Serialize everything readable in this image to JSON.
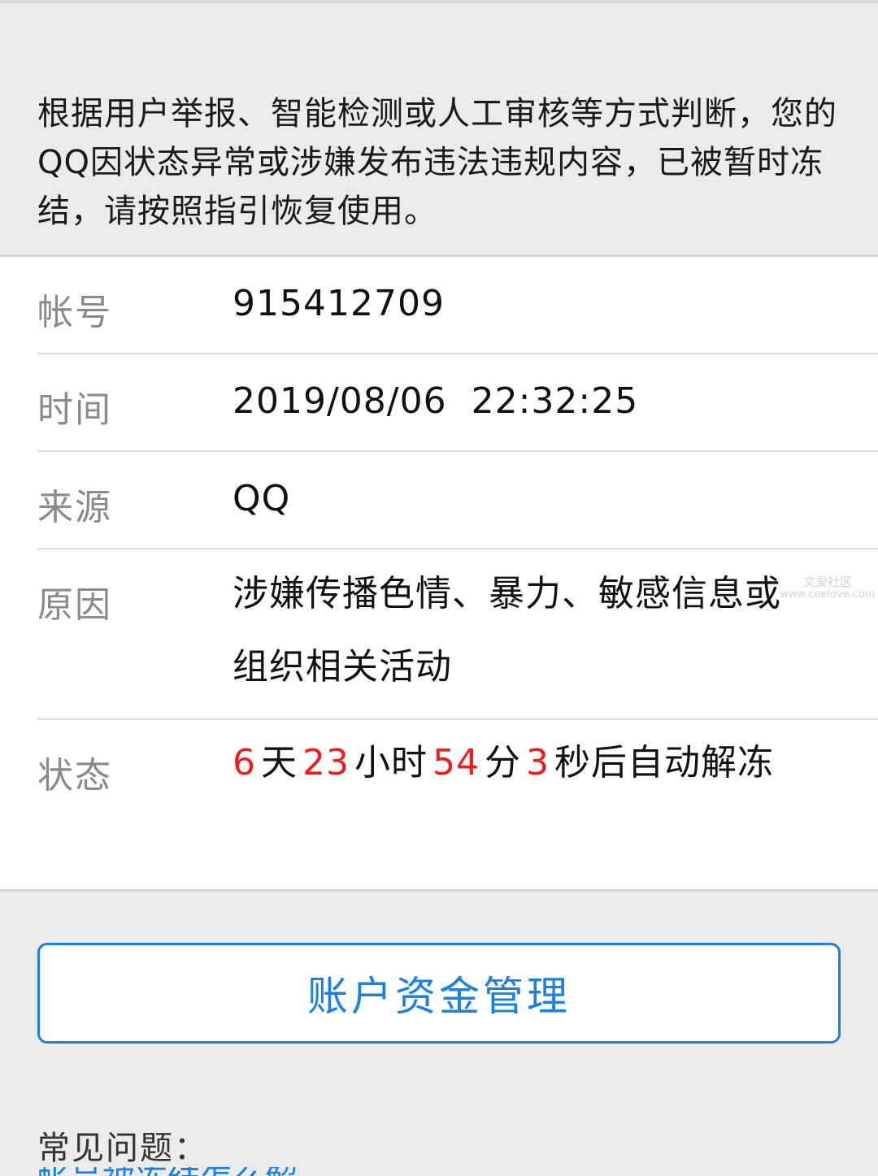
{
  "notice": {
    "text": "根据用户举报、智能检测或人工审核等方式判断，您的QQ因状态异常或涉嫌发布违法违规内容，已被暂时冻结，请按照指引恢复使用。"
  },
  "info": {
    "account": {
      "label": "帐号",
      "value": "915412709"
    },
    "time": {
      "label": "时间",
      "value": "2019/08/06  22:32:25"
    },
    "source": {
      "label": "来源",
      "value": "QQ"
    },
    "reason": {
      "label": "原因",
      "value": "涉嫌传播色情、暴力、敏感信息或组织相关活动"
    },
    "status": {
      "label": "状态",
      "days": "6",
      "days_unit": "天",
      "hours": "23",
      "hours_unit": "小时",
      "minutes": "54",
      "minutes_unit": "分",
      "seconds": "3",
      "seconds_suffix": "秒后自动解冻"
    }
  },
  "watermark": {
    "line1": "文爱社区",
    "line2": "www.ceelove.com"
  },
  "fund_button": {
    "label": "账户资金管理"
  },
  "faq": {
    "title": "常见问题：",
    "first_link": "帐号被冻结怎么解冻"
  },
  "colors": {
    "accent": "#1a7fe8",
    "countdown": "#ee1c1c",
    "background": "#ebebeb"
  }
}
